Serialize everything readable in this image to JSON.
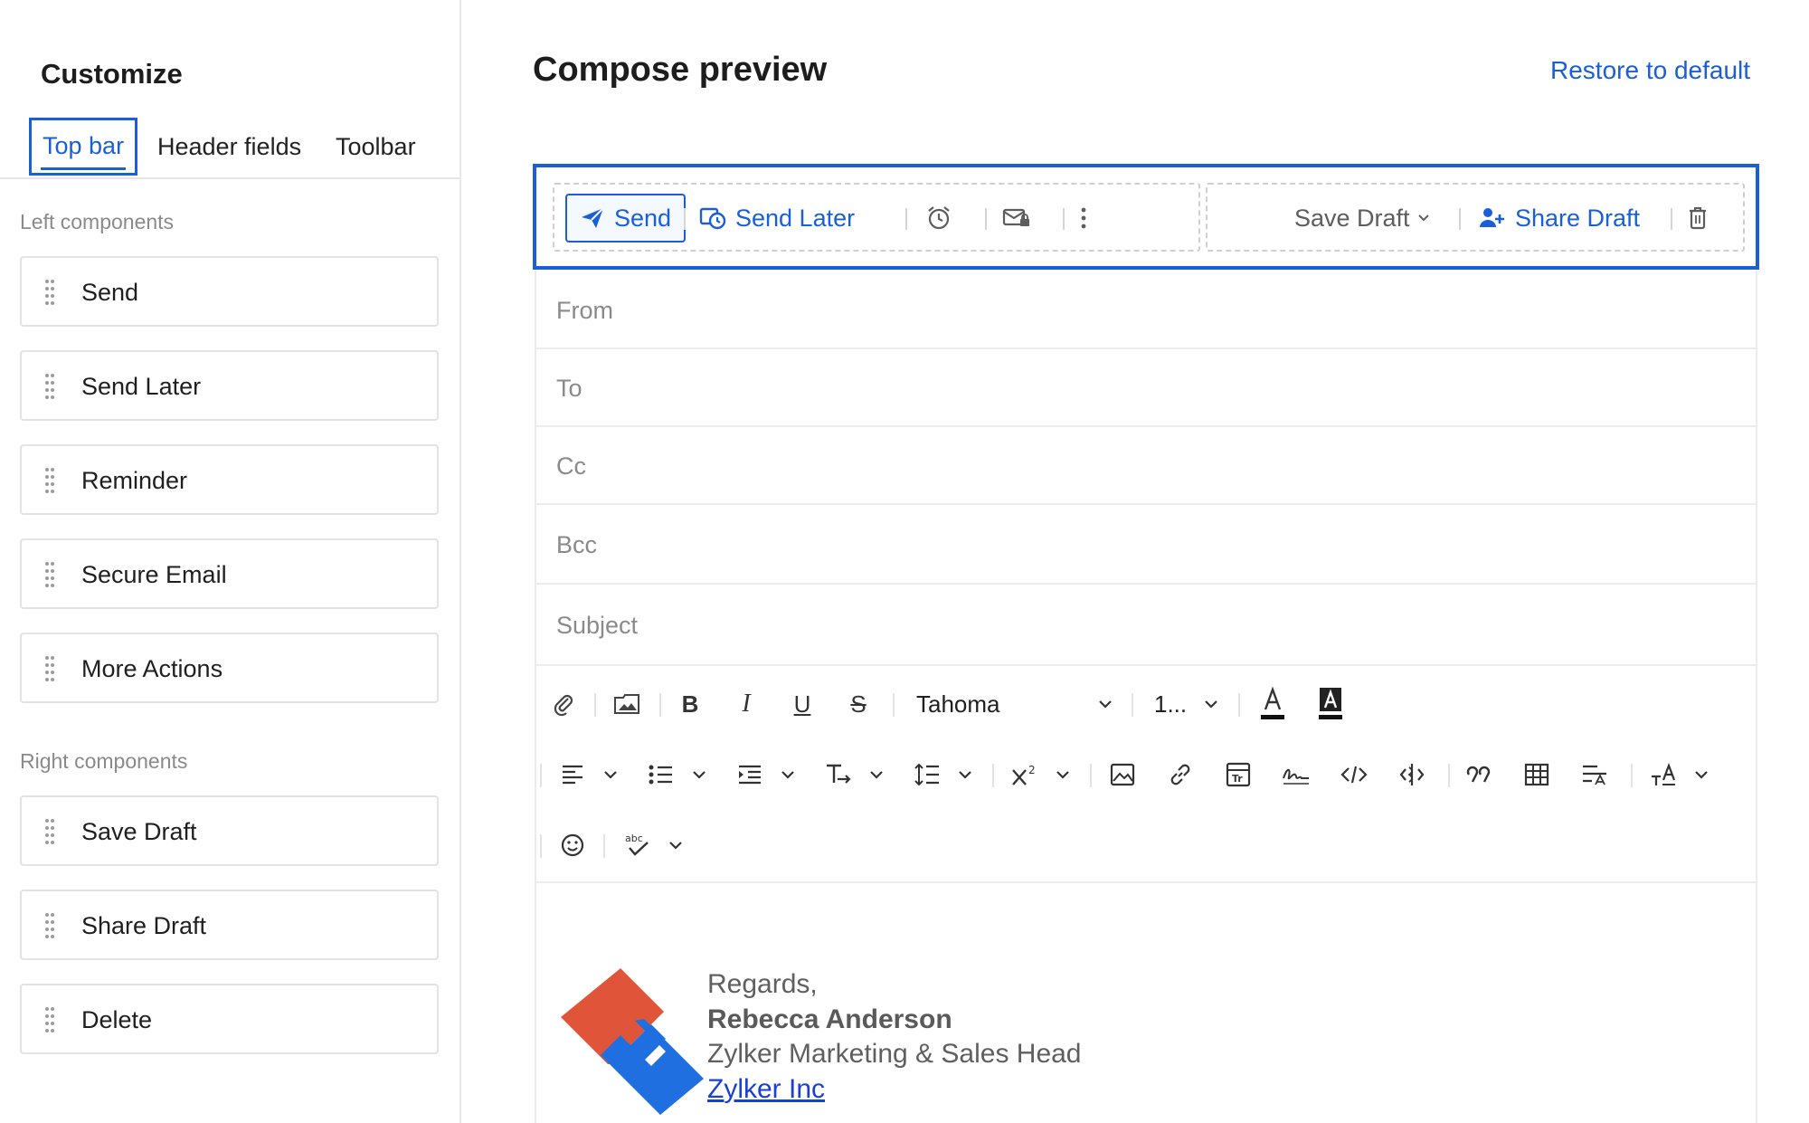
{
  "sidebar": {
    "title": "Customize",
    "tabs": [
      {
        "label": "Top bar"
      },
      {
        "label": "Header fields"
      },
      {
        "label": "Toolbar"
      }
    ],
    "left_label": "Left components",
    "left_items": [
      {
        "label": "Send"
      },
      {
        "label": "Send Later"
      },
      {
        "label": "Reminder"
      },
      {
        "label": "Secure Email"
      },
      {
        "label": "More Actions"
      }
    ],
    "right_label": "Right components",
    "right_items": [
      {
        "label": "Save Draft"
      },
      {
        "label": "Share Draft"
      },
      {
        "label": "Delete"
      }
    ]
  },
  "main": {
    "title": "Compose preview",
    "restore_label": "Restore to default",
    "topbar": {
      "send": "Send",
      "send_later": "Send Later",
      "save_draft": "Save Draft",
      "share_draft": "Share Draft"
    },
    "fields": {
      "from": "From",
      "to": "To",
      "cc": "Cc",
      "bcc": "Bcc",
      "subject": "Subject"
    },
    "format": {
      "font_name": "Tahoma",
      "font_size": "1..."
    },
    "signature": {
      "greeting": "Regards,",
      "name": "Rebecca Anderson",
      "role": "Zylker Marketing & Sales Head",
      "company": "Zylker Inc"
    }
  },
  "colors": {
    "accent": "#1a5fd6",
    "logo_orange": "#e0553a",
    "logo_blue": "#1f6fe0"
  }
}
